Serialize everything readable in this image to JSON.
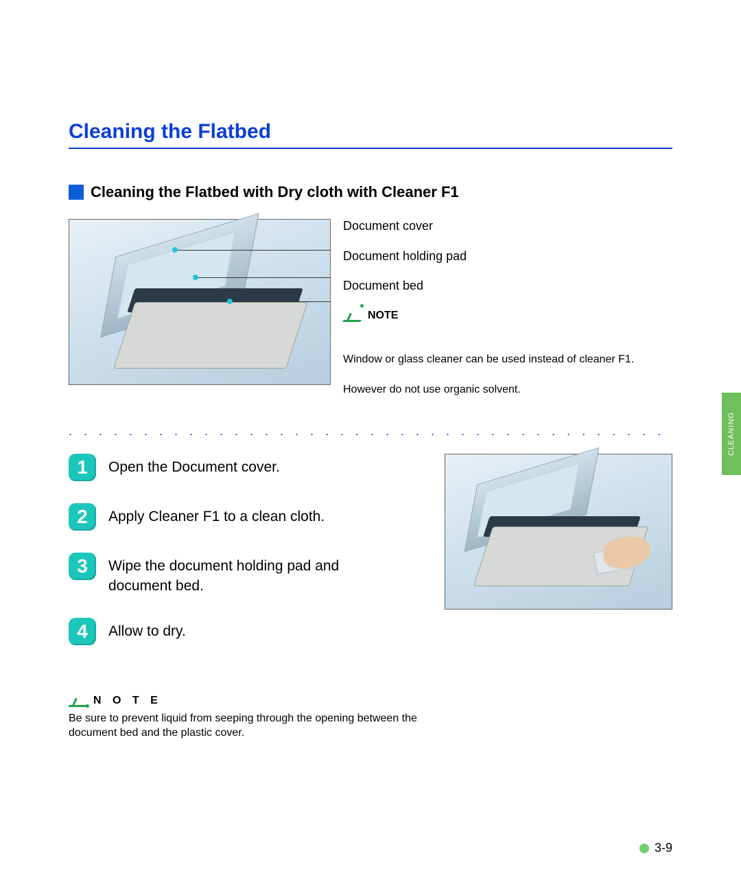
{
  "heading": "Cleaning the Flatbed",
  "subheading": "Cleaning the Flatbed with Dry cloth with Cleaner F1",
  "diagram_labels": {
    "cover": "Document cover",
    "pad": "Document holding pad",
    "bed": "Document bed"
  },
  "note1": {
    "title": "NOTE",
    "line1": "Window or glass cleaner can be used instead of cleaner F1.",
    "line2": "However do not use organic solvent."
  },
  "steps": {
    "s1": {
      "n": "1",
      "t": "Open the Document cover."
    },
    "s2": {
      "n": "2",
      "t": "Apply  Cleaner F1 to a clean cloth."
    },
    "s3": {
      "n": "3",
      "t": "Wipe the document holding pad and document bed."
    },
    "s4": {
      "n": "4",
      "t": "Allow to dry."
    }
  },
  "note2": {
    "title": "N O T E",
    "text": "Be sure to prevent liquid from seeping through the opening between the document bed and the plastic cover."
  },
  "side_tab": "CLEANING",
  "page_num": "3-9",
  "dotted": ". . . . . . . . . . . . . . . . . . . . . . . . . . . . . . . . . . . . . . . . . . . . . . . . . . . . . . . ."
}
